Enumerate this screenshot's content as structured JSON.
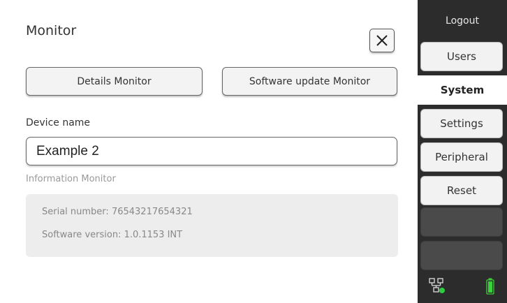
{
  "page": {
    "title": "Monitor",
    "buttons": {
      "details": "Details Monitor",
      "software_update": "Software update Monitor"
    },
    "device_name_label": "Device name",
    "device_name_value": "Example 2",
    "info_label": "Information Monitor",
    "info": {
      "serial": "Serial number: 76543217654321",
      "software": "Software version: 1.0.1153 INT"
    }
  },
  "sidebar": {
    "logout": "Logout",
    "tabs": [
      "Users",
      "System",
      "Settings",
      "Peripheral",
      "Reset"
    ],
    "active_tab": "System"
  },
  "status": {
    "network_icon": "network-connected-icon",
    "battery_icon": "battery-full-icon",
    "network_status_color": "#2ecc40",
    "battery_color": "#3ad13a"
  },
  "colors": {
    "sidebar_bg": "#2c2c2c",
    "info_box_bg": "#ededed"
  }
}
